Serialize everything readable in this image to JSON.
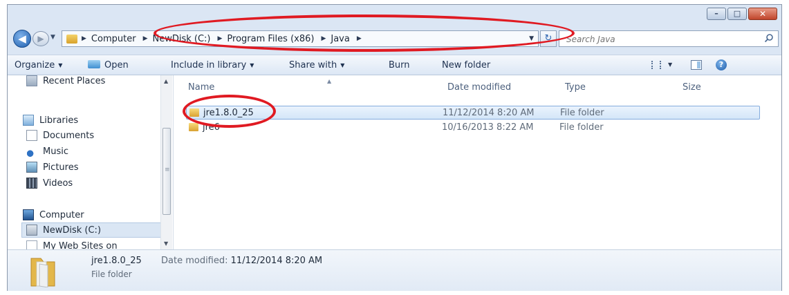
{
  "window": {
    "caption": {
      "minimize": "–",
      "maximize": "□",
      "close": "✕"
    }
  },
  "navigation": {
    "back": "◀",
    "forward": "▶",
    "history_dropdown": "▼"
  },
  "address_bar": {
    "path": [
      "Computer",
      "NewDisk (C:)",
      "Program Files (x86)",
      "Java"
    ],
    "separator": "▶",
    "dropdown": "▼",
    "refresh": "↻"
  },
  "search": {
    "placeholder": "Search Java"
  },
  "toolbar": {
    "organize": "Organize",
    "open": "Open",
    "include_in_library": "Include in library",
    "share_with": "Share with",
    "burn": "Burn",
    "new_folder": "New folder",
    "dropdown_arrow": "▼",
    "help": "?"
  },
  "nav_pane": {
    "items": [
      "Recent Places",
      "Libraries",
      "Documents",
      "Music",
      "Pictures",
      "Videos",
      "Computer",
      "NewDisk (C:)",
      "My Web Sites on"
    ],
    "selected": "NewDisk (C:)",
    "scroll_up": "▲",
    "scroll_down": "▼"
  },
  "file_list": {
    "columns": {
      "name": "Name",
      "date_modified": "Date modified",
      "type": "Type",
      "size": "Size"
    },
    "sort_indicator": "▲",
    "rows": [
      {
        "name": "jre1.8.0_25",
        "date_modified": "11/12/2014 8:20 AM",
        "type": "File folder",
        "selected": true
      },
      {
        "name": "jre6",
        "date_modified": "10/16/2013 8:22 AM",
        "type": "File folder",
        "selected": false
      }
    ]
  },
  "details_pane": {
    "name": "jre1.8.0_25",
    "date_label": "Date modified:",
    "date_value": "11/12/2014 8:20 AM",
    "type": "File folder"
  },
  "colors": {
    "annotation": "#e01a22",
    "selection_fill": "#d4e6f8",
    "selection_border": "#84acdd",
    "window_frame": "#dbe6f4"
  }
}
